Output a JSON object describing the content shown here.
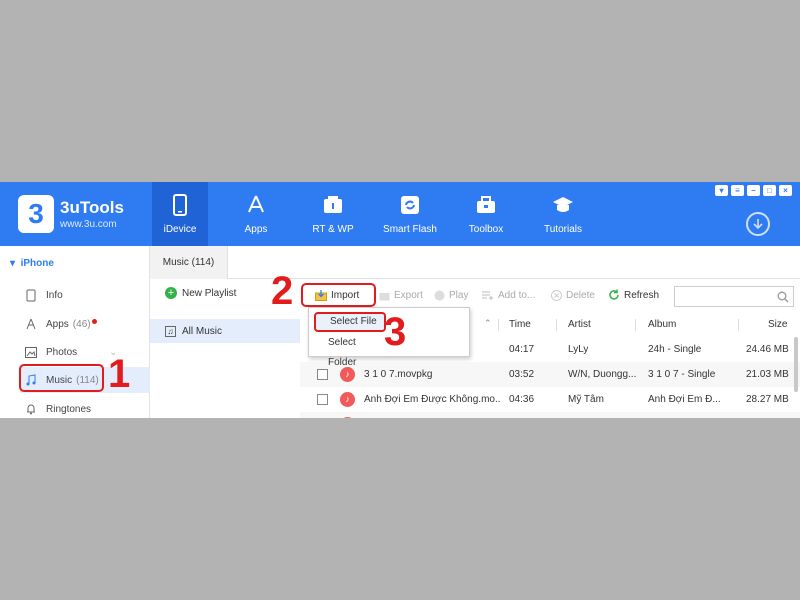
{
  "app": {
    "brand": "3uTools",
    "brand_url": "www.3u.com",
    "logo_glyph": "3",
    "accent_color": "#2f7cf2",
    "annotation_color": "#e21c1c"
  },
  "nav": [
    {
      "label": "iDevice",
      "icon": "phone-icon",
      "active": true
    },
    {
      "label": "Apps",
      "icon": "app-store-icon"
    },
    {
      "label": "RT & WP",
      "icon": "ringtone-wallpaper-icon"
    },
    {
      "label": "Smart Flash",
      "icon": "flash-icon"
    },
    {
      "label": "Toolbox",
      "icon": "toolbox-icon"
    },
    {
      "label": "Tutorials",
      "icon": "graduation-cap-icon"
    }
  ],
  "sidebar": {
    "device": "iPhone",
    "items": [
      {
        "label": "Info",
        "icon": "info-icon"
      },
      {
        "label": "Apps",
        "count": "(46)",
        "icon": "apps-icon"
      },
      {
        "label": "Photos",
        "icon": "photos-icon"
      },
      {
        "label": "Music",
        "count": "(114)",
        "icon": "music-note-icon",
        "active": true
      },
      {
        "label": "Ringtones",
        "icon": "bell-icon"
      }
    ]
  },
  "tab": {
    "label": "Music (114)"
  },
  "playlist": {
    "new_label": "New Playlist",
    "all_music": "All Music"
  },
  "toolbar": {
    "import": "Import",
    "export": "Export",
    "play": "Play",
    "add_to": "Add to...",
    "delete": "Delete",
    "refresh": "Refresh"
  },
  "import_menu": {
    "select_file": "Select File",
    "select_folder": "Select Folder"
  },
  "table": {
    "columns": {
      "time": "Time",
      "artist": "Artist",
      "album": "Album",
      "size": "Size"
    },
    "rows": [
      {
        "name": "",
        "time": "04:17",
        "artist": "LyLy",
        "album": "24h - Single",
        "size": "24.46 MB"
      },
      {
        "name": "3 1 0 7.movpkg",
        "time": "03:52",
        "artist": "W/N, Duongg...",
        "album": "3 1 0 7 - Single",
        "size": "21.03 MB"
      },
      {
        "name": "Anh Đợi Em Được Không.mo...",
        "time": "04:36",
        "artist": "Mỹ Tâm",
        "album": "Anh Đợi Em Đ...",
        "size": "28.27 MB"
      }
    ]
  },
  "steps": {
    "one": "1",
    "two": "2",
    "three": "3"
  }
}
